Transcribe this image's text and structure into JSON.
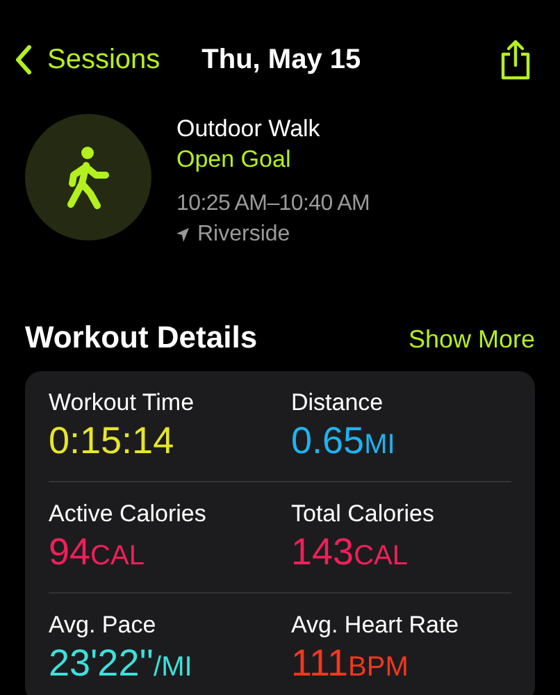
{
  "nav": {
    "back": "Sessions",
    "title": "Thu, May 15"
  },
  "workout": {
    "name": "Outdoor Walk",
    "goal": "Open Goal",
    "time": "10:25 AM–10:40 AM",
    "location": "Riverside"
  },
  "section": {
    "title": "Workout Details",
    "action": "Show More"
  },
  "metrics": [
    {
      "label": "Workout Time",
      "value": "0:15:14",
      "color": "#e6e62a"
    },
    {
      "label": "Distance",
      "value": "0.65",
      "unit": "MI",
      "color": "#1fb2ee"
    },
    {
      "label": "Active Calories",
      "value": "94",
      "unit": "CAL",
      "color": "#f01f5a"
    },
    {
      "label": "Total Calories",
      "value": "143",
      "unit": "CAL",
      "color": "#f01f5a"
    },
    {
      "label": "Avg. Pace",
      "value": "23'22''",
      "unit": "/MI",
      "color": "#3ee0dc"
    },
    {
      "label": "Avg. Heart Rate",
      "value": "111",
      "unit": "BPM",
      "color": "#f5361f"
    }
  ]
}
